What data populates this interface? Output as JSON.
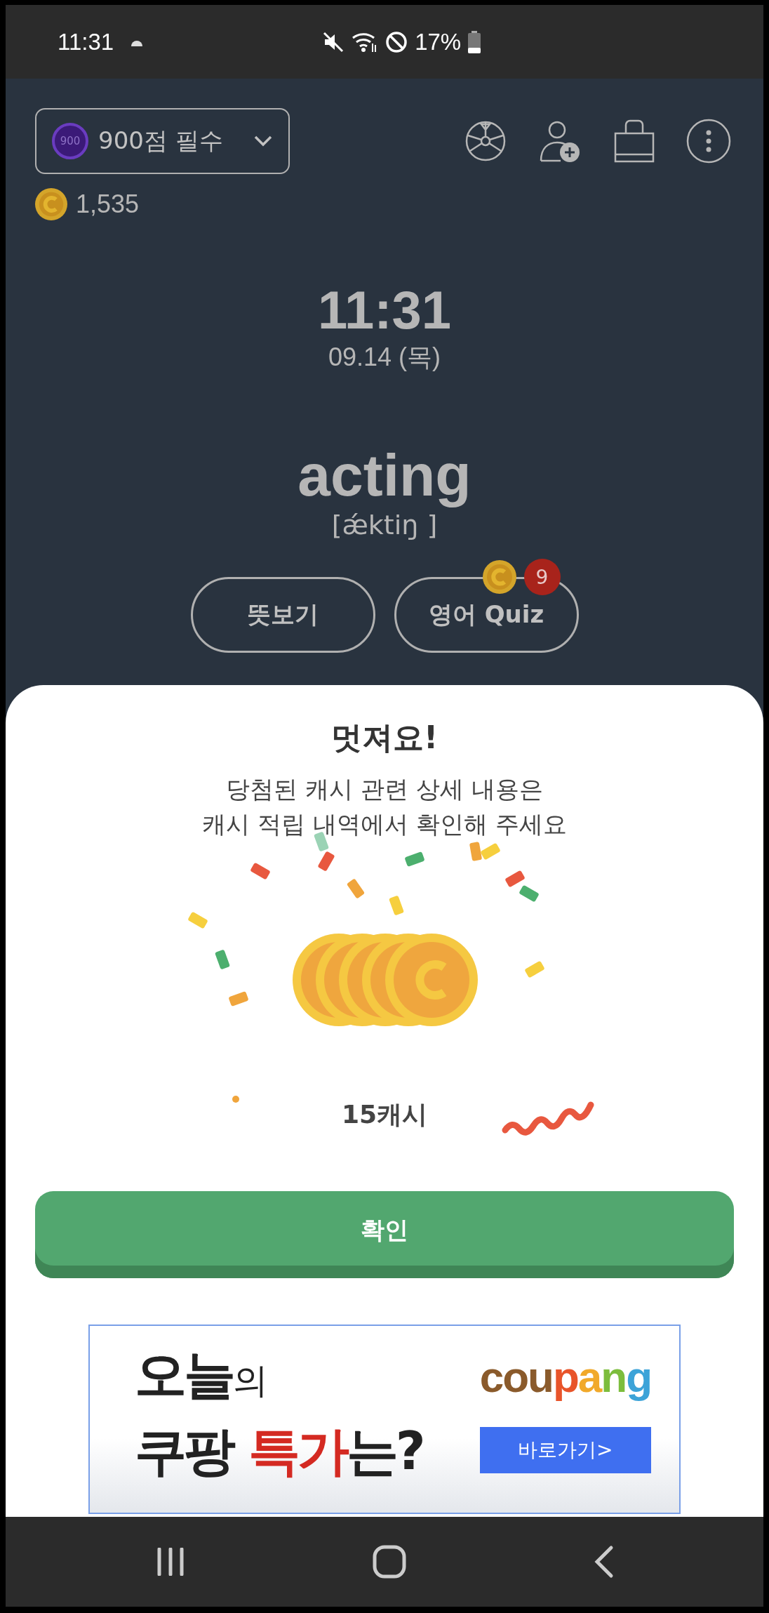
{
  "status_bar": {
    "time": "11:31",
    "battery": "17%"
  },
  "header": {
    "level_badge": "900",
    "level_name": "900점 필수",
    "coins": "1,535"
  },
  "clock": {
    "time": "11:31",
    "date": "09.14 (목)"
  },
  "word": {
    "text": "acting",
    "pronunciation": "[ǽktiŋ ]"
  },
  "actions": [
    {
      "label": "뜻보기"
    },
    {
      "label": "영어 Quiz",
      "badge": "9"
    }
  ],
  "dialog": {
    "title": "멋져요!",
    "message_lines": [
      "당첨된 캐시 관련 상세 내용은",
      "캐시 적립 내역에서 확인해 주세요"
    ],
    "reward": "15캐시",
    "confirm": "확인"
  },
  "ad": {
    "line_1": [
      {
        "text": "오늘",
        "kind": "large"
      },
      {
        "text": "의",
        "kind": "small"
      }
    ],
    "line_2": [
      {
        "text": "쿠팡 ",
        "kind": "large"
      },
      {
        "text": "특가",
        "kind": "accent"
      },
      {
        "text": "는?",
        "kind": "large"
      }
    ],
    "brand": "coupang",
    "cta": "바로가기>"
  }
}
